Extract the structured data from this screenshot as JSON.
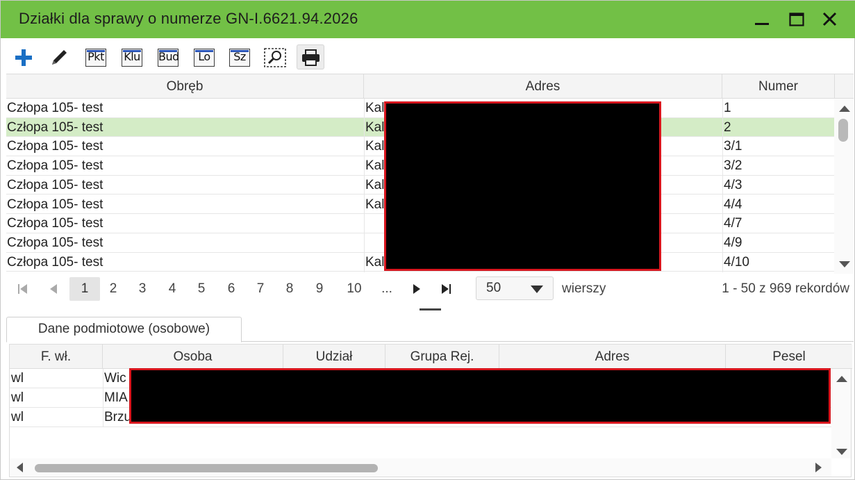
{
  "window": {
    "title": "Działki dla sprawy o numerze GN-I.6621.94.2026"
  },
  "toolbar": {
    "buttons": [
      {
        "name": "add",
        "icon": "plus-icon"
      },
      {
        "name": "edit",
        "icon": "pencil-icon"
      },
      {
        "name": "pkt",
        "icon": "label-icon",
        "label": "Pkt"
      },
      {
        "name": "klu",
        "icon": "label-icon",
        "label": "Klu"
      },
      {
        "name": "bud",
        "icon": "label-icon",
        "label": "Bud"
      },
      {
        "name": "lo",
        "icon": "label-icon",
        "label": "Lo"
      },
      {
        "name": "sz",
        "icon": "label-icon",
        "label": "Sz"
      },
      {
        "name": "zoom-selection",
        "icon": "zoom-selection-icon"
      },
      {
        "name": "print",
        "icon": "print-icon"
      }
    ]
  },
  "plots": {
    "columns": [
      "Obręb",
      "Adres",
      "Numer"
    ],
    "rows": [
      {
        "obreb": "Człopa 105- test",
        "adres": "Kal",
        "numer": "1"
      },
      {
        "obreb": "Człopa 105- test",
        "adres": "Kal",
        "numer": "2"
      },
      {
        "obreb": "Człopa 105- test",
        "adres": "Kal",
        "numer": "3/1"
      },
      {
        "obreb": "Człopa 105- test",
        "adres": "Kal",
        "numer": "3/2"
      },
      {
        "obreb": "Człopa 105- test",
        "adres": "Kal",
        "numer": "4/3"
      },
      {
        "obreb": "Człopa 105- test",
        "adres": "Kal",
        "numer": "4/4"
      },
      {
        "obreb": "Człopa 105- test",
        "adres": "",
        "numer": "4/7"
      },
      {
        "obreb": "Człopa 105- test",
        "adres": "",
        "numer": "4/9"
      },
      {
        "obreb": "Człopa 105- test",
        "adres": "Kal",
        "numer": "4/10"
      }
    ],
    "selected_row": 1
  },
  "pager": {
    "pages": [
      "1",
      "2",
      "3",
      "4",
      "5",
      "6",
      "7",
      "8",
      "9",
      "10",
      "..."
    ],
    "current_page": "1",
    "page_size": "50",
    "rows_label": "wierszy",
    "records_info": "1 - 50 z 969 rekordów"
  },
  "tabs": [
    {
      "label": "Dane podmiotowe (osobowe)",
      "active": true
    }
  ],
  "owners": {
    "columns": [
      "F. wł.",
      "Osoba",
      "Udział",
      "Grupa Rej.",
      "Adres",
      "Pesel"
    ],
    "rows": [
      {
        "fwl": "wl",
        "osoba": "Wic"
      },
      {
        "fwl": "wl",
        "osoba": "MIA"
      },
      {
        "fwl": "wl",
        "osoba": "Brzu"
      }
    ]
  },
  "colors": {
    "titlebar": "#72c046",
    "selected_row": "#d4ecc6",
    "redaction": "#000000",
    "redaction_border": "#d8161e",
    "icon_blue": "#1a6fc4"
  }
}
